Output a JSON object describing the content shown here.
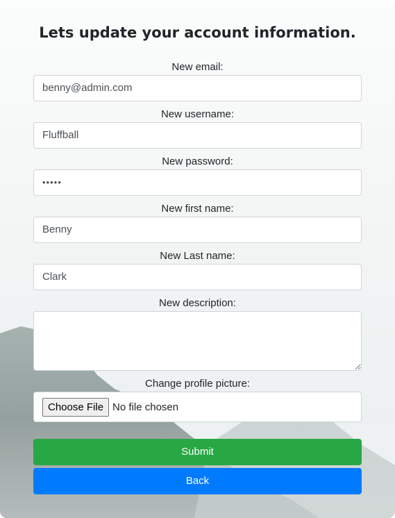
{
  "page": {
    "title": "Lets update your account information."
  },
  "fields": {
    "email": {
      "label": "New email:",
      "value": "benny@admin.com"
    },
    "username": {
      "label": "New username:",
      "value": "Fluffball"
    },
    "password": {
      "label": "New password:",
      "value": "•••••"
    },
    "first_name": {
      "label": "New first name:",
      "value": "Benny"
    },
    "last_name": {
      "label": "New Last name:",
      "value": "Clark"
    },
    "description": {
      "label": "New description:",
      "value": ""
    },
    "profile_picture": {
      "label": "Change profile picture:",
      "button_label": "Choose File",
      "status": "No file chosen"
    }
  },
  "actions": {
    "submit_label": "Submit",
    "back_label": "Back"
  },
  "colors": {
    "submit": "#28a745",
    "back": "#007bff",
    "input_border": "#ced4da"
  }
}
